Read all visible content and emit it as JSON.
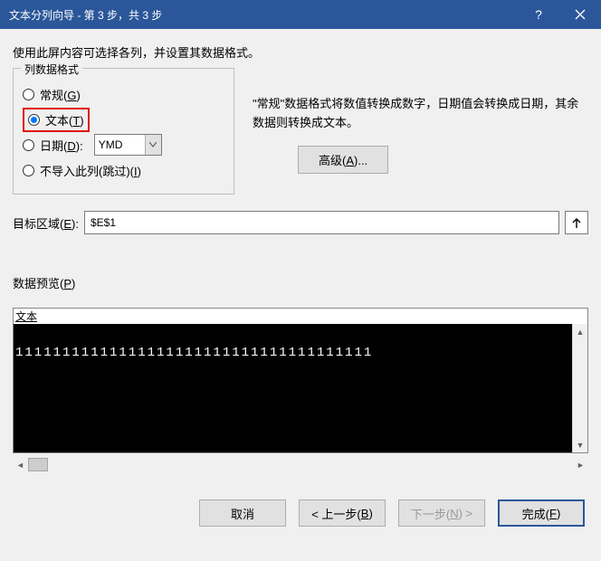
{
  "titlebar": {
    "title": "文本分列向导 - 第 3 步，共 3 步"
  },
  "instruction": "使用此屏内容可选择各列，并设置其数据格式。",
  "group": {
    "label": "列数据格式",
    "options": {
      "general_pre": "常规(",
      "general_key": "G",
      "general_post": ")",
      "text_pre": "文本(",
      "text_key": "T",
      "text_post": ")",
      "date_pre": "日期(",
      "date_key": "D",
      "date_post": "):",
      "date_format": "YMD",
      "skip_pre": "不导入此列(跳过)(",
      "skip_key": "I",
      "skip_post": ")"
    }
  },
  "description": "\"常规\"数据格式将数值转换成数字，日期值会转换成日期，其余数据则转换成文本。",
  "advanced_pre": "高级(",
  "advanced_key": "A",
  "advanced_post": ")...",
  "destination": {
    "label_pre": "目标区域(",
    "label_key": "E",
    "label_post": "):",
    "value": "$E$1"
  },
  "preview": {
    "label_pre": "数据预览(",
    "label_key": "P",
    "label_post": ")",
    "header": "文本",
    "row1": "11111111111111111111111111111111111111"
  },
  "buttons": {
    "cancel": "取消",
    "back_pre": "< 上一步(",
    "back_key": "B",
    "back_post": ")",
    "next_pre": "下一步(",
    "next_key": "N",
    "next_post": ") >",
    "finish_pre": "完成(",
    "finish_key": "F",
    "finish_post": ")"
  }
}
